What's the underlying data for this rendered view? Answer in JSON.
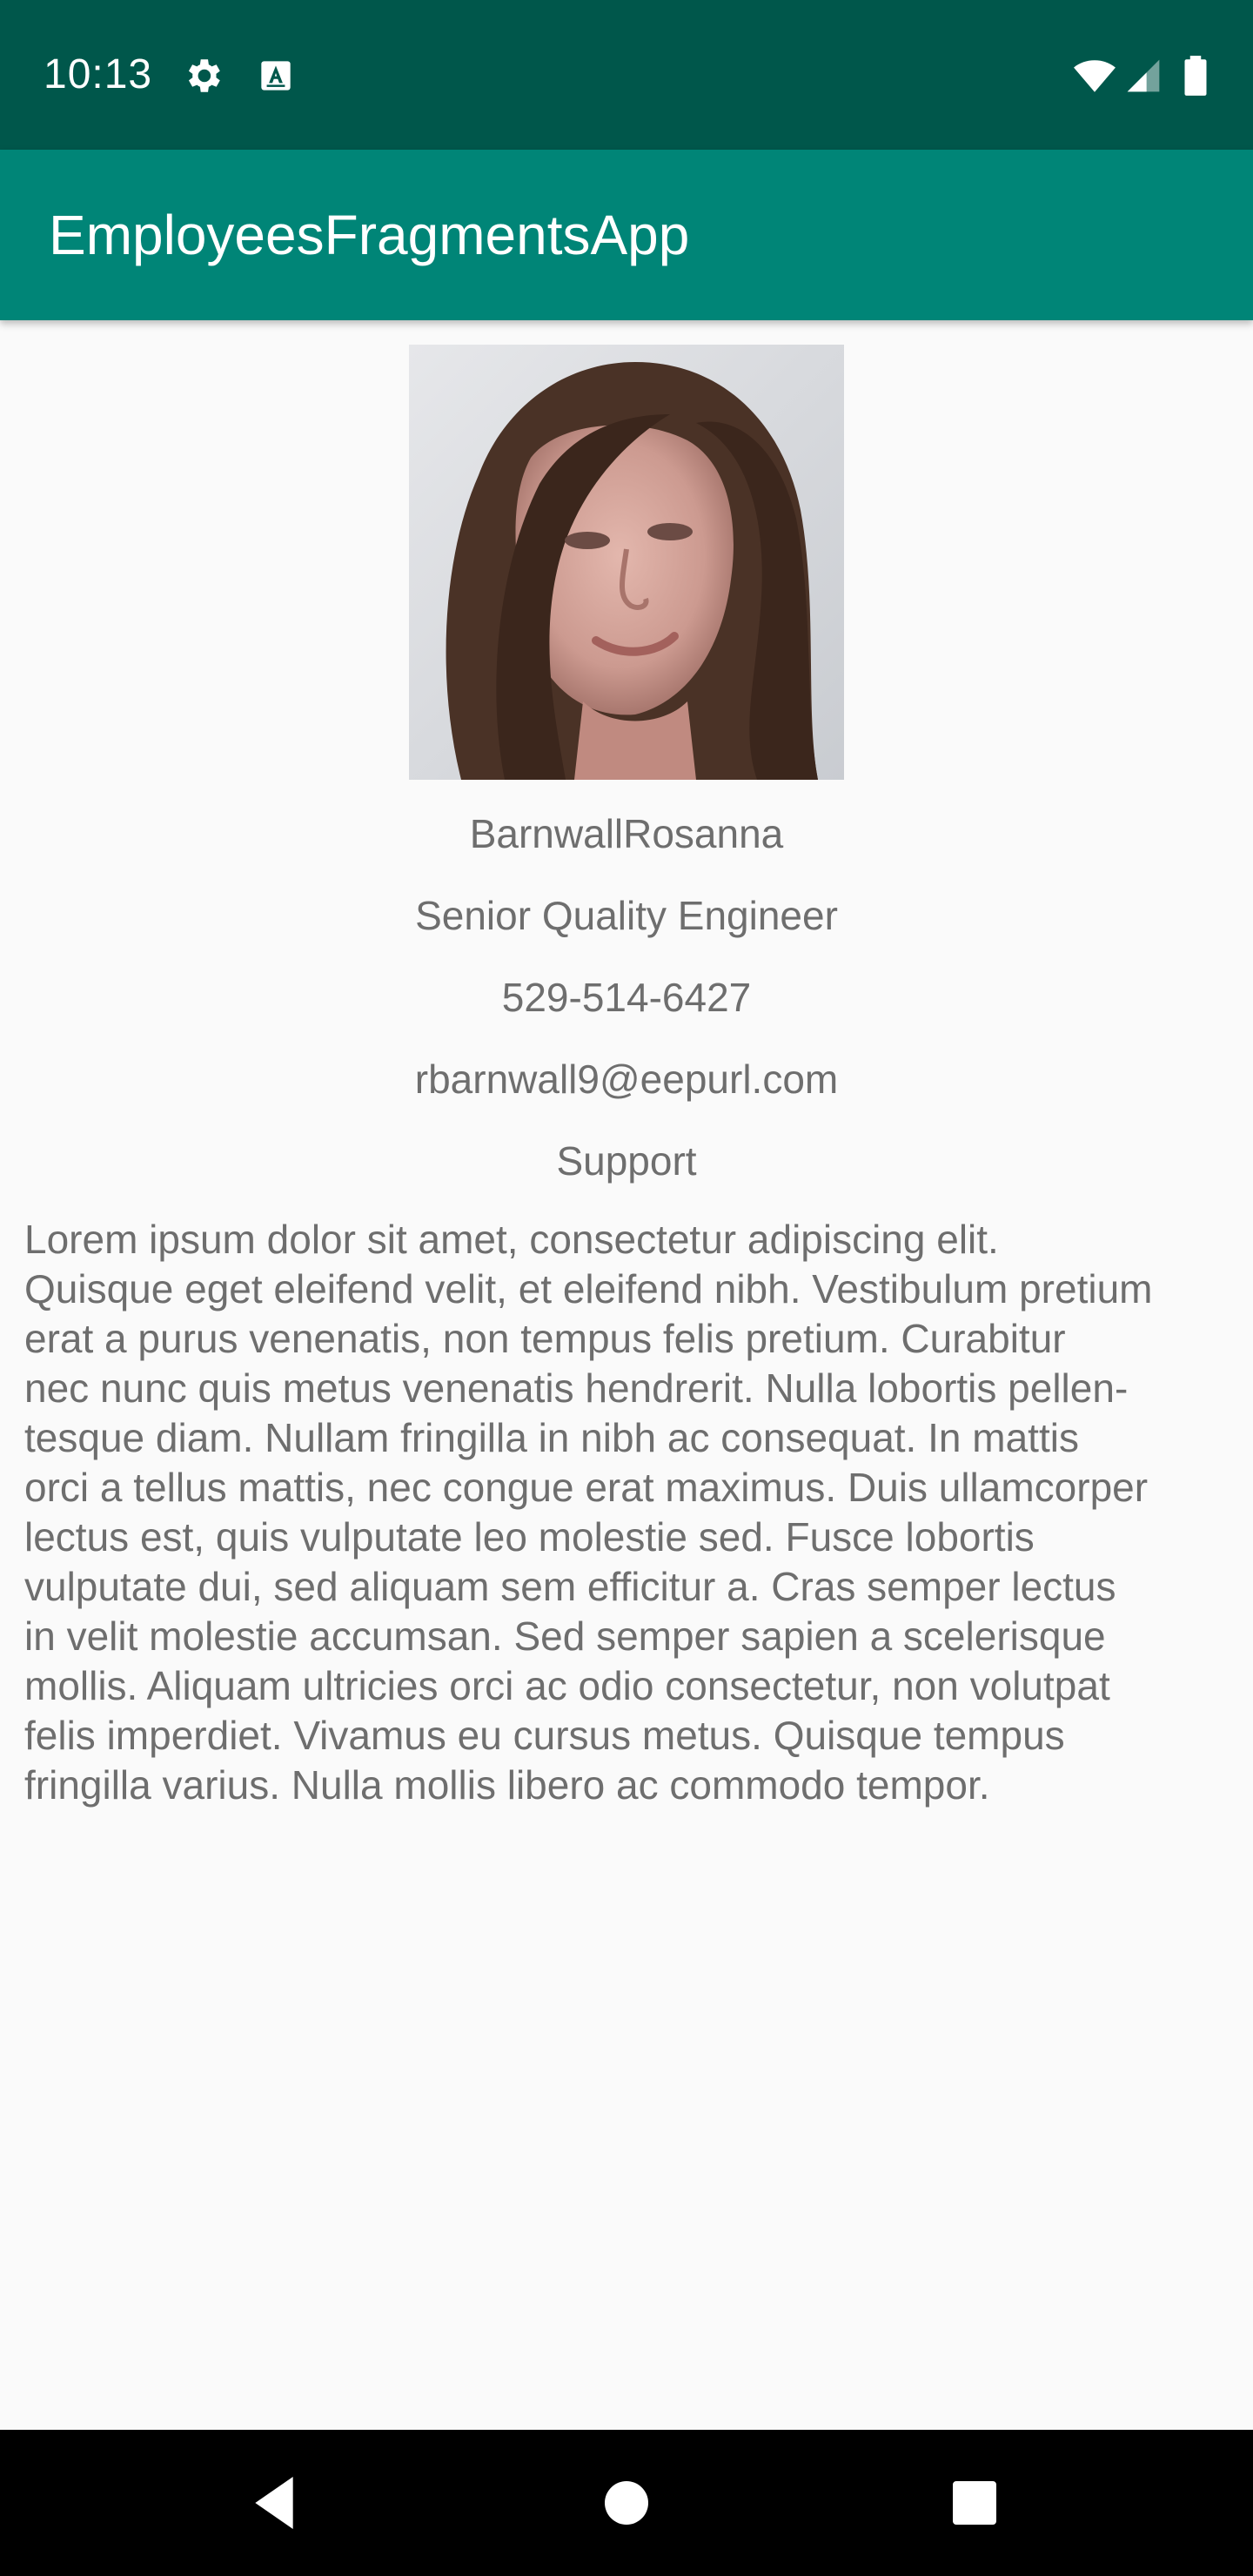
{
  "status_bar": {
    "time": "10:13",
    "icons": [
      "gear-icon",
      "text-a-icon",
      "wifi-icon",
      "signal-icon",
      "battery-icon"
    ],
    "background_color": "#00574b"
  },
  "app_bar": {
    "title": "EmployeesFragmentsApp",
    "background_color": "#008577"
  },
  "employee": {
    "name": "BarnwallRosanna",
    "title": "Senior Quality Engineer",
    "phone": "529-514-6427",
    "email": "rbarnwall9@eepurl.com",
    "department": "Support",
    "bio": "Lorem ipsum dolor sit amet, consectetur adipiscing elit.\nQuisque eget eleifend velit, et eleifend nibh. Vestibulum pretium\nerat a purus venenatis, non tempus felis pretium. Curabitur\nnec nunc quis metus venenatis hendrerit. Nulla lobortis pellen-\ntesque diam. Nullam fringilla in nibh ac consequat. In mattis\norci a tellus mattis, nec congue erat maximus. Duis ullamcorper\nlectus est, quis vulputate leo molestie sed. Fusce lobortis\nvulputate dui, sed aliquam sem efficitur a. Cras semper lectus\nin velit molestie accumsan. Sed semper sapien a scelerisque\nmollis. Aliquam ultricies orci ac odio consectetur, non volutpat\nfelis imperdiet. Vivamus eu cursus metus. Quisque tempus\nfringilla varius. Nulla mollis libero ac commodo tempor."
  },
  "nav_bar": {
    "buttons": [
      "back-icon",
      "home-icon",
      "recents-icon"
    ]
  }
}
